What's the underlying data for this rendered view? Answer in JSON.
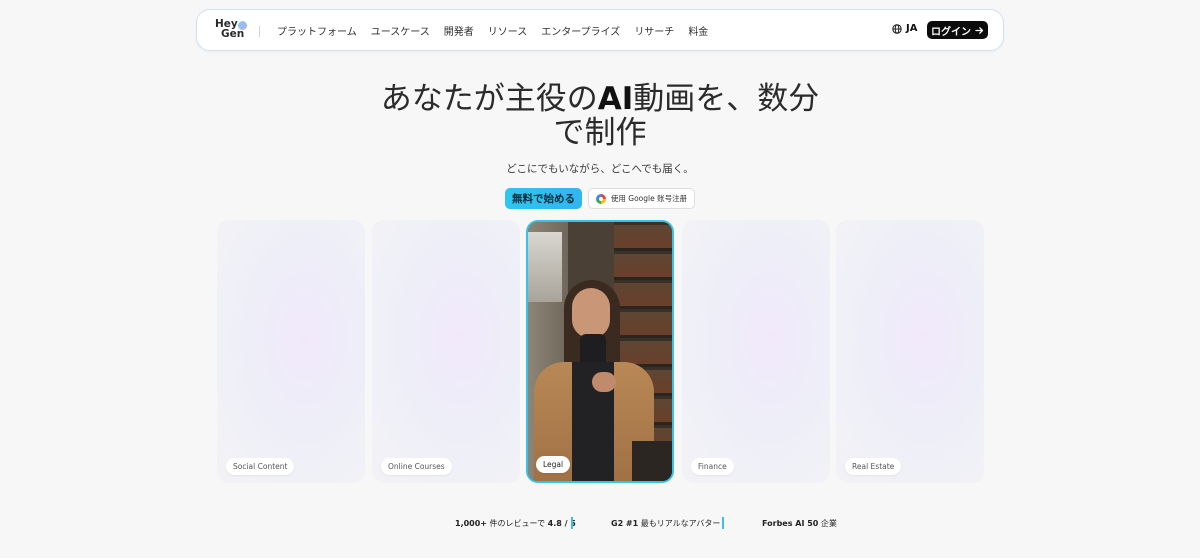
{
  "nav": {
    "logo_line1": "Hey",
    "logo_line2": "Gen",
    "links": [
      "プラットフォーム",
      "ユースケース",
      "開発者",
      "リソース",
      "エンタープライズ",
      "リサーチ",
      "料金"
    ],
    "language": "JA",
    "login_label": "ログイン"
  },
  "hero": {
    "title_before": "あなたが主役の",
    "title_bold": "AI",
    "title_after_line1": "動画を、数分",
    "title_line2": "で制作",
    "subtitle": "どこにでもいながら、どこへでも届く。",
    "cta_primary": "無料で始める",
    "cta_google": "使用 Google 账号注册"
  },
  "cards": [
    {
      "label": "Social Content"
    },
    {
      "label": "Online Courses"
    },
    {
      "label": "Legal"
    },
    {
      "label": "Finance"
    },
    {
      "label": "Real Estate"
    }
  ],
  "stats": {
    "reviews_prefix": "1,000+",
    "reviews_middle": " 件のレビューで ",
    "reviews_rating": "4.8 / 5",
    "g2_prefix": "G2 #1",
    "g2_text": " 最もリアルなアバター",
    "forbes_prefix": "Forbes AI 50",
    "forbes_text": " 企業"
  },
  "colors": {
    "accent": "#34c3ea",
    "login_bg": "#0b0b0b",
    "page_bg": "#f7f7f8"
  },
  "icons": {
    "globe": "globe-icon",
    "arrow": "arrow-right-icon",
    "google": "google-icon"
  }
}
